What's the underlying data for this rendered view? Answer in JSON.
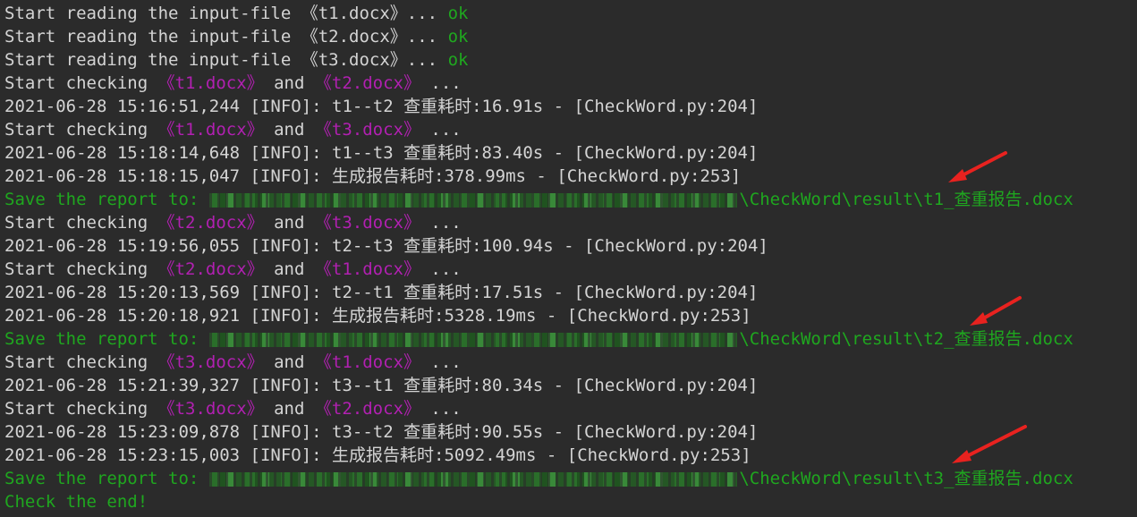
{
  "lines": [
    {
      "segments": [
        {
          "text": "Start reading the input-file 《t1.docx》... ",
          "color": "default"
        },
        {
          "text": "ok",
          "color": "ok"
        }
      ]
    },
    {
      "segments": [
        {
          "text": "Start reading the input-file 《t2.docx》... ",
          "color": "default"
        },
        {
          "text": "ok",
          "color": "ok"
        }
      ]
    },
    {
      "segments": [
        {
          "text": "Start reading the input-file 《t3.docx》... ",
          "color": "default"
        },
        {
          "text": "ok",
          "color": "ok"
        }
      ]
    },
    {
      "segments": [
        {
          "text": "Start checking ",
          "color": "default"
        },
        {
          "text": "《t1.docx》",
          "color": "magenta"
        },
        {
          "text": " and ",
          "color": "default"
        },
        {
          "text": "《t2.docx》",
          "color": "magenta"
        },
        {
          "text": " ...",
          "color": "default"
        }
      ]
    },
    {
      "segments": [
        {
          "text": "2021-06-28 15:16:51,244 [INFO]: t1--t2 查重耗时:16.91s - [CheckWord.py:204]",
          "color": "default"
        }
      ]
    },
    {
      "segments": [
        {
          "text": "Start checking ",
          "color": "default"
        },
        {
          "text": "《t1.docx》",
          "color": "magenta"
        },
        {
          "text": " and ",
          "color": "default"
        },
        {
          "text": "《t3.docx》",
          "color": "magenta"
        },
        {
          "text": " ...",
          "color": "default"
        }
      ]
    },
    {
      "segments": [
        {
          "text": "2021-06-28 15:18:14,648 [INFO]: t1--t3 查重耗时:83.40s - [CheckWord.py:204]",
          "color": "default"
        }
      ]
    },
    {
      "segments": [
        {
          "text": "2021-06-28 15:18:15,047 [INFO]: 生成报告耗时:378.99ms - [CheckWord.py:253]",
          "color": "default"
        }
      ]
    },
    {
      "segments": [
        {
          "text": "Save the report to:",
          "color": "green"
        },
        {
          "redacted": true
        },
        {
          "text": "\\CheckWord\\result\\t1_查重报告.docx",
          "color": "green"
        }
      ]
    },
    {
      "segments": [
        {
          "text": "Start checking ",
          "color": "default"
        },
        {
          "text": "《t2.docx》",
          "color": "magenta"
        },
        {
          "text": " and ",
          "color": "default"
        },
        {
          "text": "《t3.docx》",
          "color": "magenta"
        },
        {
          "text": " ...",
          "color": "default"
        }
      ]
    },
    {
      "segments": [
        {
          "text": "2021-06-28 15:19:56,055 [INFO]: t2--t3 查重耗时:100.94s - [CheckWord.py:204]",
          "color": "default"
        }
      ]
    },
    {
      "segments": [
        {
          "text": "Start checking ",
          "color": "default"
        },
        {
          "text": "《t2.docx》",
          "color": "magenta"
        },
        {
          "text": " and ",
          "color": "default"
        },
        {
          "text": "《t1.docx》",
          "color": "magenta"
        },
        {
          "text": " ...",
          "color": "default"
        }
      ]
    },
    {
      "segments": [
        {
          "text": "2021-06-28 15:20:13,569 [INFO]: t2--t1 查重耗时:17.51s - [CheckWord.py:204]",
          "color": "default"
        }
      ]
    },
    {
      "segments": [
        {
          "text": "2021-06-28 15:20:18,921 [INFO]: 生成报告耗时:5328.19ms - [CheckWord.py:253]",
          "color": "default"
        }
      ]
    },
    {
      "segments": [
        {
          "text": "Save the report to:",
          "color": "green"
        },
        {
          "redacted": true
        },
        {
          "text": "\\CheckWord\\result\\t2_查重报告.docx",
          "color": "green"
        }
      ]
    },
    {
      "segments": [
        {
          "text": "Start checking ",
          "color": "default"
        },
        {
          "text": "《t3.docx》",
          "color": "magenta"
        },
        {
          "text": " and ",
          "color": "default"
        },
        {
          "text": "《t1.docx》",
          "color": "magenta"
        },
        {
          "text": " ...",
          "color": "default"
        }
      ]
    },
    {
      "segments": [
        {
          "text": "2021-06-28 15:21:39,327 [INFO]: t3--t1 查重耗时:80.34s - [CheckWord.py:204]",
          "color": "default"
        }
      ]
    },
    {
      "segments": [
        {
          "text": "Start checking ",
          "color": "default"
        },
        {
          "text": "《t3.docx》",
          "color": "magenta"
        },
        {
          "text": " and ",
          "color": "default"
        },
        {
          "text": "《t2.docx》",
          "color": "magenta"
        },
        {
          "text": " ...",
          "color": "default"
        }
      ]
    },
    {
      "segments": [
        {
          "text": "2021-06-28 15:23:09,878 [INFO]: t3--t2 查重耗时:90.55s - [CheckWord.py:204]",
          "color": "default"
        }
      ]
    },
    {
      "segments": [
        {
          "text": "2021-06-28 15:23:15,003 [INFO]: 生成报告耗时:5092.49ms - [CheckWord.py:253]",
          "color": "default"
        }
      ]
    },
    {
      "segments": [
        {
          "text": "Save the report to:",
          "color": "green"
        },
        {
          "redacted": true
        },
        {
          "text": "\\CheckWord\\result\\t3_查重报告.docx",
          "color": "green"
        }
      ]
    },
    {
      "segments": [
        {
          "text": "Check the end!",
          "color": "green"
        }
      ]
    }
  ],
  "annotations": {
    "arrow_icon": "red-arrow-icon",
    "arrow_color": "#e8221f"
  },
  "colors": {
    "background": "#2b2b2b",
    "default_text": "#d4d4d4",
    "ok": "#1fa71f",
    "magenta": "#b120b1",
    "green": "#1fa71f"
  }
}
